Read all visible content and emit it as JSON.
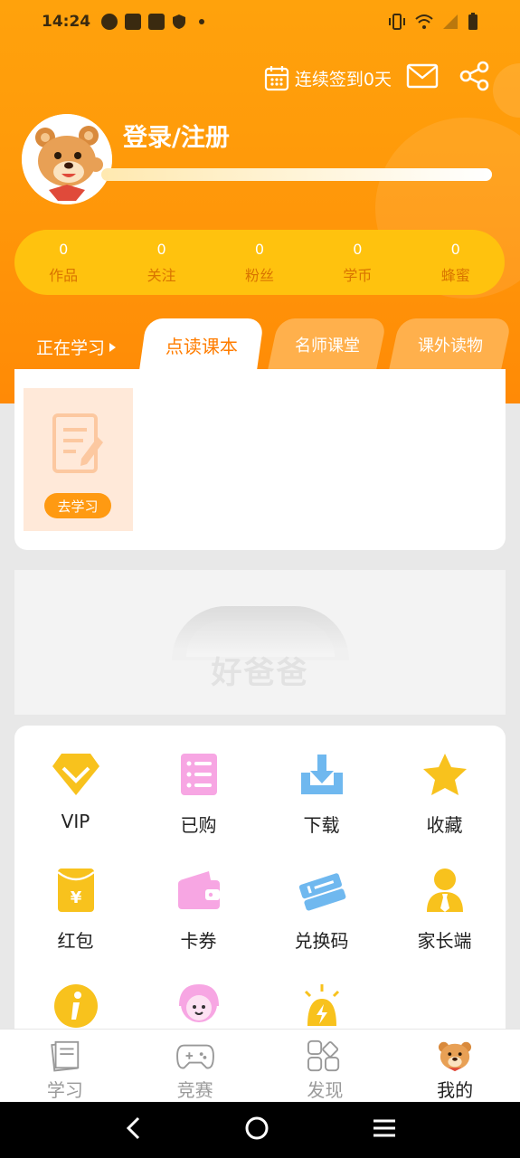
{
  "status_bar": {
    "time": "14:24",
    "left_icons": [
      "moon-icon",
      "bag-icon",
      "bag-icon",
      "shield-icon",
      "dot-icon"
    ],
    "right_icons": [
      "vibrate-icon",
      "wifi-icon",
      "signal-icon",
      "battery-icon"
    ]
  },
  "header": {
    "checkin_label": "连续签到0天",
    "icons": [
      "calendar-icon",
      "mail-icon",
      "share-icon"
    ]
  },
  "profile": {
    "login_label": "登录/注册",
    "progress_fraction": 1.0
  },
  "stats": [
    {
      "value": "0",
      "label": "作品"
    },
    {
      "value": "0",
      "label": "关注"
    },
    {
      "value": "0",
      "label": "粉丝"
    },
    {
      "value": "0",
      "label": "学币"
    },
    {
      "value": "0",
      "label": "蜂蜜"
    }
  ],
  "learning_label": "正在学习",
  "tabs": [
    {
      "label": "点读课本",
      "active": true
    },
    {
      "label": "名师课堂",
      "active": false
    },
    {
      "label": "课外读物",
      "active": false
    }
  ],
  "study_card": {
    "button_label": "去学习"
  },
  "banner": {
    "logo_text": "好爸爸"
  },
  "grid": [
    {
      "label": "VIP",
      "icon": "diamond-icon",
      "color": "#f8c21d"
    },
    {
      "label": "已购",
      "icon": "list-icon",
      "color": "#f7a6e3"
    },
    {
      "label": "下载",
      "icon": "download-icon",
      "color": "#6fb8ef"
    },
    {
      "label": "收藏",
      "icon": "star-icon",
      "color": "#f8c21d"
    },
    {
      "label": "红包",
      "icon": "red-envelope-icon",
      "color": "#f8c21d"
    },
    {
      "label": "卡券",
      "icon": "wallet-icon",
      "color": "#f7a6e3"
    },
    {
      "label": "兑换码",
      "icon": "ticket-icon",
      "color": "#6fb8ef"
    },
    {
      "label": "家长端",
      "icon": "parent-icon",
      "color": "#f8c21d"
    },
    {
      "label": "",
      "icon": "info-icon",
      "color": "#f8c21d"
    },
    {
      "label": "",
      "icon": "service-icon",
      "color": "#f7a6e3"
    },
    {
      "label": "",
      "icon": "lamp-icon",
      "color": "#f8c21d"
    }
  ],
  "bottom_nav": [
    {
      "label": "学习",
      "icon": "book-stack-icon"
    },
    {
      "label": "竞赛",
      "icon": "gamepad-icon"
    },
    {
      "label": "发现",
      "icon": "apps-icon"
    },
    {
      "label": "我的",
      "icon": "bear-icon",
      "active": true
    }
  ],
  "system_nav": [
    "back-icon",
    "home-icon",
    "menu-icon"
  ],
  "colors": {
    "accent": "#ff9a0a",
    "stats_bar": "#ffc20e",
    "button": "#ff9a12"
  }
}
